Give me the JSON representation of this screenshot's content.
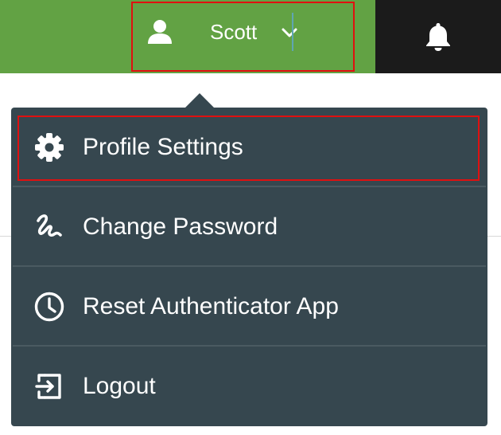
{
  "header": {
    "user_name": "Scott",
    "user_icon": "user-icon",
    "chevron_icon": "chevron-down-icon",
    "notification_icon": "bell-icon",
    "colors": {
      "bar": "#62a244",
      "notif_bg": "#1b1b1b"
    }
  },
  "dropdown": {
    "items": [
      {
        "label": "Profile Settings",
        "icon": "gear-icon"
      },
      {
        "label": "Change Password",
        "icon": "signature-icon"
      },
      {
        "label": "Reset Authenticator App",
        "icon": "clock-icon"
      },
      {
        "label": "Logout",
        "icon": "logout-icon"
      }
    ],
    "colors": {
      "bg": "#36474f",
      "highlight": "#e01010"
    }
  }
}
